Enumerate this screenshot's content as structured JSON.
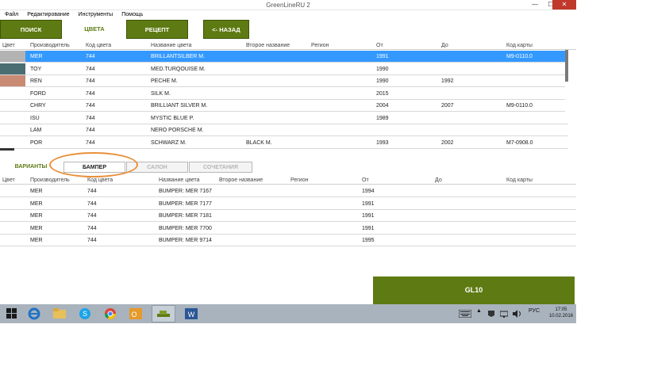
{
  "window": {
    "title": "GreenLineRU 2",
    "minimize": "—",
    "maximize": "☐",
    "close": "✕"
  },
  "menu": [
    "Файл",
    "Редактирование",
    "Инструменты",
    "Помощь"
  ],
  "nav": {
    "search": "ПОИСК",
    "colors": "ЦВЕТА",
    "recipe": "РЕЦЕПТ",
    "back": "<- НАЗАД"
  },
  "colors_table": {
    "headers": [
      "Цвет",
      "Производитель",
      "Код цвета",
      "Название цвета",
      "Второе название",
      "Регион",
      "От",
      "До",
      "Код карты"
    ],
    "rows": [
      {
        "swatch": "#b3b3b3",
        "maker": "MER",
        "code": "744",
        "name": "BRILLANTSILBER M.",
        "second": "",
        "region": "",
        "from": "1991",
        "to": "",
        "card": "M9-0110.0",
        "selected": true
      },
      {
        "swatch": "#4b6e73",
        "maker": "TOY",
        "code": "744",
        "name": "MED.TURQOUISE M.",
        "second": "",
        "region": "",
        "from": "1990",
        "to": "",
        "card": ""
      },
      {
        "swatch": "#c98b74",
        "maker": "REN",
        "code": "744",
        "name": "PECHE M.",
        "second": "",
        "region": "",
        "from": "1990",
        "to": "1992",
        "card": ""
      },
      {
        "swatch": "",
        "maker": "FORD",
        "code": "744",
        "name": "SILK M.",
        "second": "",
        "region": "",
        "from": "2015",
        "to": "",
        "card": ""
      },
      {
        "swatch": "",
        "maker": "CHRY",
        "code": "744",
        "name": "BRILLIANT SILVER M.",
        "second": "",
        "region": "",
        "from": "2004",
        "to": "2007",
        "card": "M9-0110.0"
      },
      {
        "swatch": "",
        "maker": "ISU",
        "code": "744",
        "name": "MYSTIC BLUE P.",
        "second": "",
        "region": "",
        "from": "1989",
        "to": "",
        "card": ""
      },
      {
        "swatch": "",
        "maker": "LAM",
        "code": "744",
        "name": "NERO PORSCHE M.",
        "second": "",
        "region": "",
        "from": "",
        "to": "",
        "card": ""
      },
      {
        "swatch": "",
        "maker": "POR",
        "code": "744",
        "name": "SCHWARZ M.",
        "second": "BLACK M.",
        "region": "",
        "from": "1993",
        "to": "2002",
        "card": "M7-0908.0"
      }
    ]
  },
  "tabs": {
    "variants": "ВАРИАНТЫ",
    "bumper": "БАМПЕР",
    "salon": "САЛОН",
    "combos": "СОЧЕТАНИЯ"
  },
  "bumper_table": {
    "headers": [
      "Цвет",
      "Производитель",
      "Код цвета",
      "Название цвета",
      "Второе название",
      "Регион",
      "От",
      "До",
      "Код карты"
    ],
    "rows": [
      {
        "maker": "MER",
        "code": "744",
        "name": "BUMPER: MER 7167",
        "from": "1994"
      },
      {
        "maker": "MER",
        "code": "744",
        "name": "BUMPER: MER 7177",
        "from": "1991"
      },
      {
        "maker": "MER",
        "code": "744",
        "name": "BUMPER: MER 7181",
        "from": "1991"
      },
      {
        "maker": "MER",
        "code": "744",
        "name": "BUMPER: MER 7700",
        "from": "1991"
      },
      {
        "maker": "MER",
        "code": "744",
        "name": "BUMPER: MER 9714",
        "from": "1995"
      }
    ]
  },
  "action_button": "GL10",
  "taskbar": {
    "lang": "РУС",
    "time": "17:05",
    "date": "10.02.2016"
  },
  "accent": "#5e7a12",
  "selection": "#3399ff",
  "highlight": "#e8903a"
}
